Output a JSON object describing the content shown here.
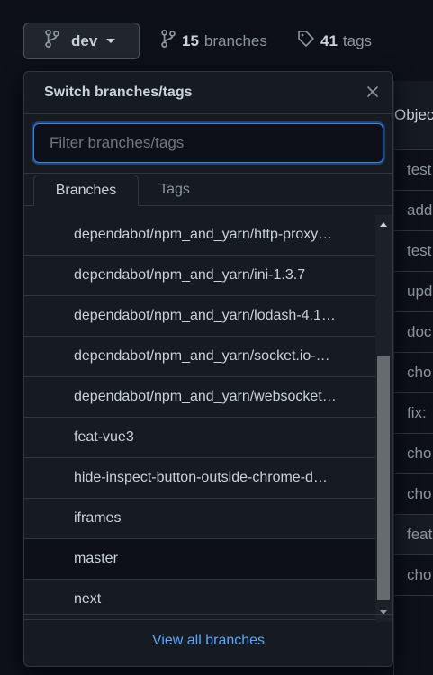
{
  "toolbar": {
    "branch_name": "dev",
    "branches_count": "15",
    "branches_label": "branches",
    "tags_count": "41",
    "tags_label": "tags"
  },
  "background_table": {
    "header": "Object",
    "rows": [
      "test",
      "add",
      "test",
      "upd",
      "doc",
      "cho",
      "fix:",
      "cho",
      "cho",
      "feat",
      "cho"
    ]
  },
  "dropdown": {
    "title": "Switch branches/tags",
    "filter_placeholder": "Filter branches/tags",
    "filter_value": "",
    "tabs": [
      {
        "label": "Branches",
        "active": true
      },
      {
        "label": "Tags",
        "active": false
      }
    ],
    "branches": [
      "dependabot/npm_and_yarn/http-proxy…",
      "dependabot/npm_and_yarn/ini-1.3.7",
      "dependabot/npm_and_yarn/lodash-4.1…",
      "dependabot/npm_and_yarn/socket.io-…",
      "dependabot/npm_and_yarn/websocket…",
      "feat-vue3",
      "hide-inspect-button-outside-chrome-d…",
      "iframes",
      "master",
      "next"
    ],
    "selected_branch_index": 8,
    "footer_link": "View all branches"
  },
  "colors": {
    "accent": "#58a6ff",
    "background": "#0d1117",
    "panel": "#161b22",
    "border": "#30363d"
  }
}
